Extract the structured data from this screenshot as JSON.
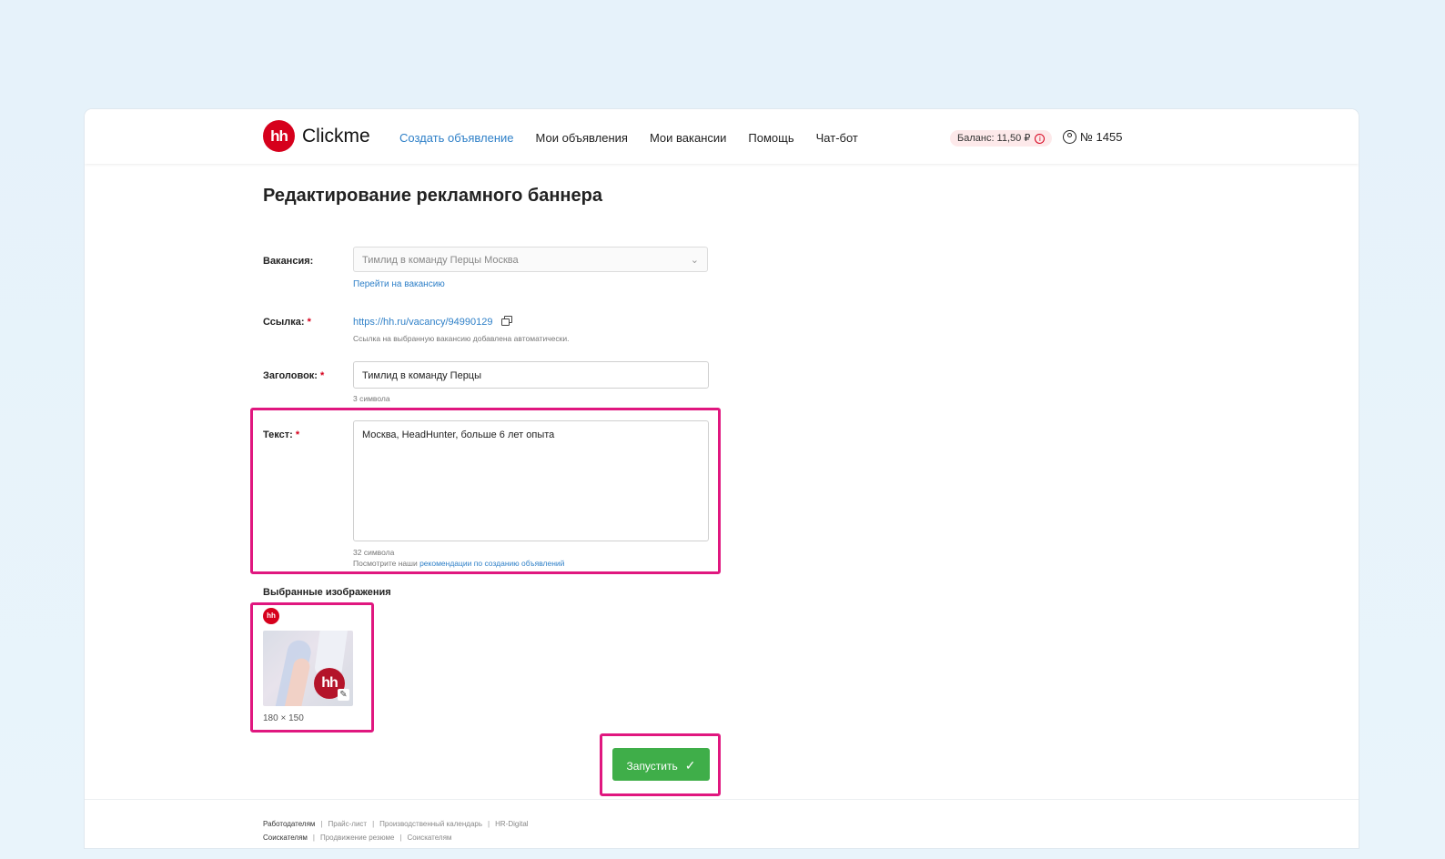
{
  "header": {
    "logo_text": "Clickme",
    "logo_badge": "hh",
    "nav": [
      "Создать объявление",
      "Мои объявления",
      "Мои вакансии",
      "Помощь",
      "Чат-бот"
    ],
    "balance": "Баланс: 11,50 ₽",
    "balance_info_icon": "i",
    "account": "№ 1455"
  },
  "page": {
    "title": "Редактирование рекламного баннера"
  },
  "form": {
    "vacancy_label": "Вакансия:",
    "vacancy_value": "Тимлид в команду Перцы Москва",
    "vacancy_link": "Перейти на вакансию",
    "link_label": "Ссылка:",
    "link_url": "https://hh.ru/vacancy/94990129",
    "link_hint": "Ссылка на выбранную вакансию добавлена автоматически.",
    "headline_label": "Заголовок:",
    "headline_value": "Тимлид в команду Перцы",
    "headline_count": "3 символа",
    "text_label": "Текст:",
    "text_value": "Москва, HeadHunter, больше 6 лет опыта",
    "text_count": "32 символа",
    "text_hint_prefix": "Посмотрите наши ",
    "text_hint_link": "рекомендации по созданию объявлений",
    "required_mark": "*"
  },
  "images": {
    "title": "Выбранные изображения",
    "badge": "hh",
    "thumb_logo": "hh",
    "size": "180 × 150"
  },
  "actions": {
    "launch_label": "Запустить",
    "launch_icon": "✓"
  },
  "footer": {
    "row1": [
      "Работодателям",
      "Прайс-лист",
      "Производственный календарь",
      "HR-Digital"
    ],
    "row2": [
      "Соискателям",
      "Продвижение резюме",
      "Соискателям"
    ]
  },
  "colors": {
    "accent_link": "#2f80c8",
    "brand_red": "#d6001c",
    "button_green": "#3fae49",
    "highlight": "#e0177f"
  }
}
